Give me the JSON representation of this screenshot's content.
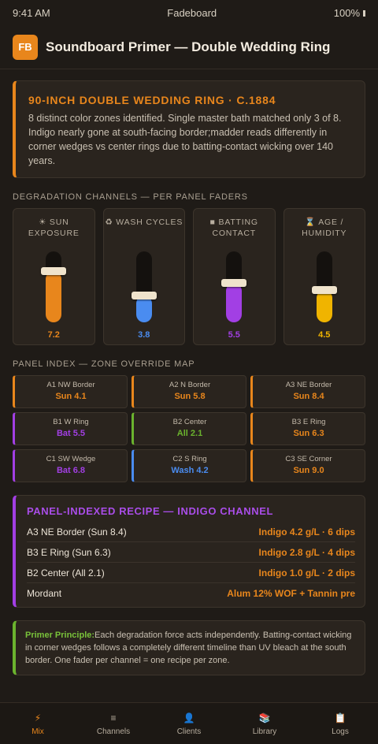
{
  "status": {
    "time": "9:41 AM",
    "carrier": "Fadeboard",
    "battery": "100%"
  },
  "header": {
    "logo": "FB",
    "title": "Soundboard Primer — Double Wedding Ring"
  },
  "intro": {
    "title": "90-INCH DOUBLE WEDDING RING · C.1884",
    "body": "8 distinct color zones identified. Single master bath matched only 3 of 8. Indigo nearly gone at south-facing border;madder reads differently in corner wedges vs center rings due to batting-contact wicking over 140 years."
  },
  "channels": {
    "section_label": "DEGRADATION CHANNELS — PER PANEL FADERS",
    "items": [
      {
        "icon": "☀",
        "label": "SUN EXPOSURE",
        "value": "7.2",
        "level": 0.72,
        "color": "#e8861c"
      },
      {
        "icon": "♻",
        "label": "WASH CYCLES",
        "value": "3.8",
        "level": 0.38,
        "color": "#4a8cf0"
      },
      {
        "icon": "■",
        "label": "BATTING CONTACT",
        "value": "5.5",
        "level": 0.55,
        "color": "#a23fe4"
      },
      {
        "icon": "⌛",
        "label": "AGE / HUMIDITY",
        "value": "4.5",
        "level": 0.45,
        "color": "#f0b400"
      }
    ]
  },
  "zones": {
    "section_label": "PANEL INDEX — ZONE OVERRIDE MAP",
    "items": [
      {
        "name": "A1 NW Border",
        "value": "Sun 4.1",
        "color": "#e8861c"
      },
      {
        "name": "A2 N Border",
        "value": "Sun 5.8",
        "color": "#e8861c"
      },
      {
        "name": "A3 NE Border",
        "value": "Sun 8.4",
        "color": "#e8861c"
      },
      {
        "name": "B1 W Ring",
        "value": "Bat 5.5",
        "color": "#a23fe4"
      },
      {
        "name": "B2 Center",
        "value": "All 2.1",
        "color": "#6bb32e"
      },
      {
        "name": "B3 E Ring",
        "value": "Sun 6.3",
        "color": "#e8861c"
      },
      {
        "name": "C1 SW Wedge",
        "value": "Bat 6.8",
        "color": "#a23fe4"
      },
      {
        "name": "C2 S Ring",
        "value": "Wash 4.2",
        "color": "#4a8cf0"
      },
      {
        "name": "C3 SE Corner",
        "value": "Sun 9.0",
        "color": "#e8861c"
      }
    ]
  },
  "recipe": {
    "title": "PANEL-INDEXED RECIPE — INDIGO CHANNEL",
    "rows": [
      {
        "left": "A3 NE Border (Sun 8.4)",
        "right": "Indigo 4.2 g/L · 6 dips"
      },
      {
        "left": "B3 E Ring (Sun 6.3)",
        "right": "Indigo 2.8 g/L · 4 dips"
      },
      {
        "left": "B2 Center (All 2.1)",
        "right": "Indigo 1.0 g/L · 2 dips"
      },
      {
        "left": "Mordant",
        "right": "Alum 12% WOF + Tannin pre"
      }
    ]
  },
  "principle": {
    "head": "Primer Principle:",
    "body": "Each degradation force acts independently. Batting-contact wicking in corner wedges follows a completely different timeline than UV bleach at the south border. One fader per channel = one recipe per zone."
  },
  "tabs": [
    {
      "icon": "⚡",
      "label": "Mix",
      "active": true
    },
    {
      "icon": "≡",
      "label": "Channels",
      "active": false
    },
    {
      "icon": "👤",
      "label": "Clients",
      "active": false
    },
    {
      "icon": "📚",
      "label": "Library",
      "active": false
    },
    {
      "icon": "📋",
      "label": "Logs",
      "active": false
    }
  ]
}
